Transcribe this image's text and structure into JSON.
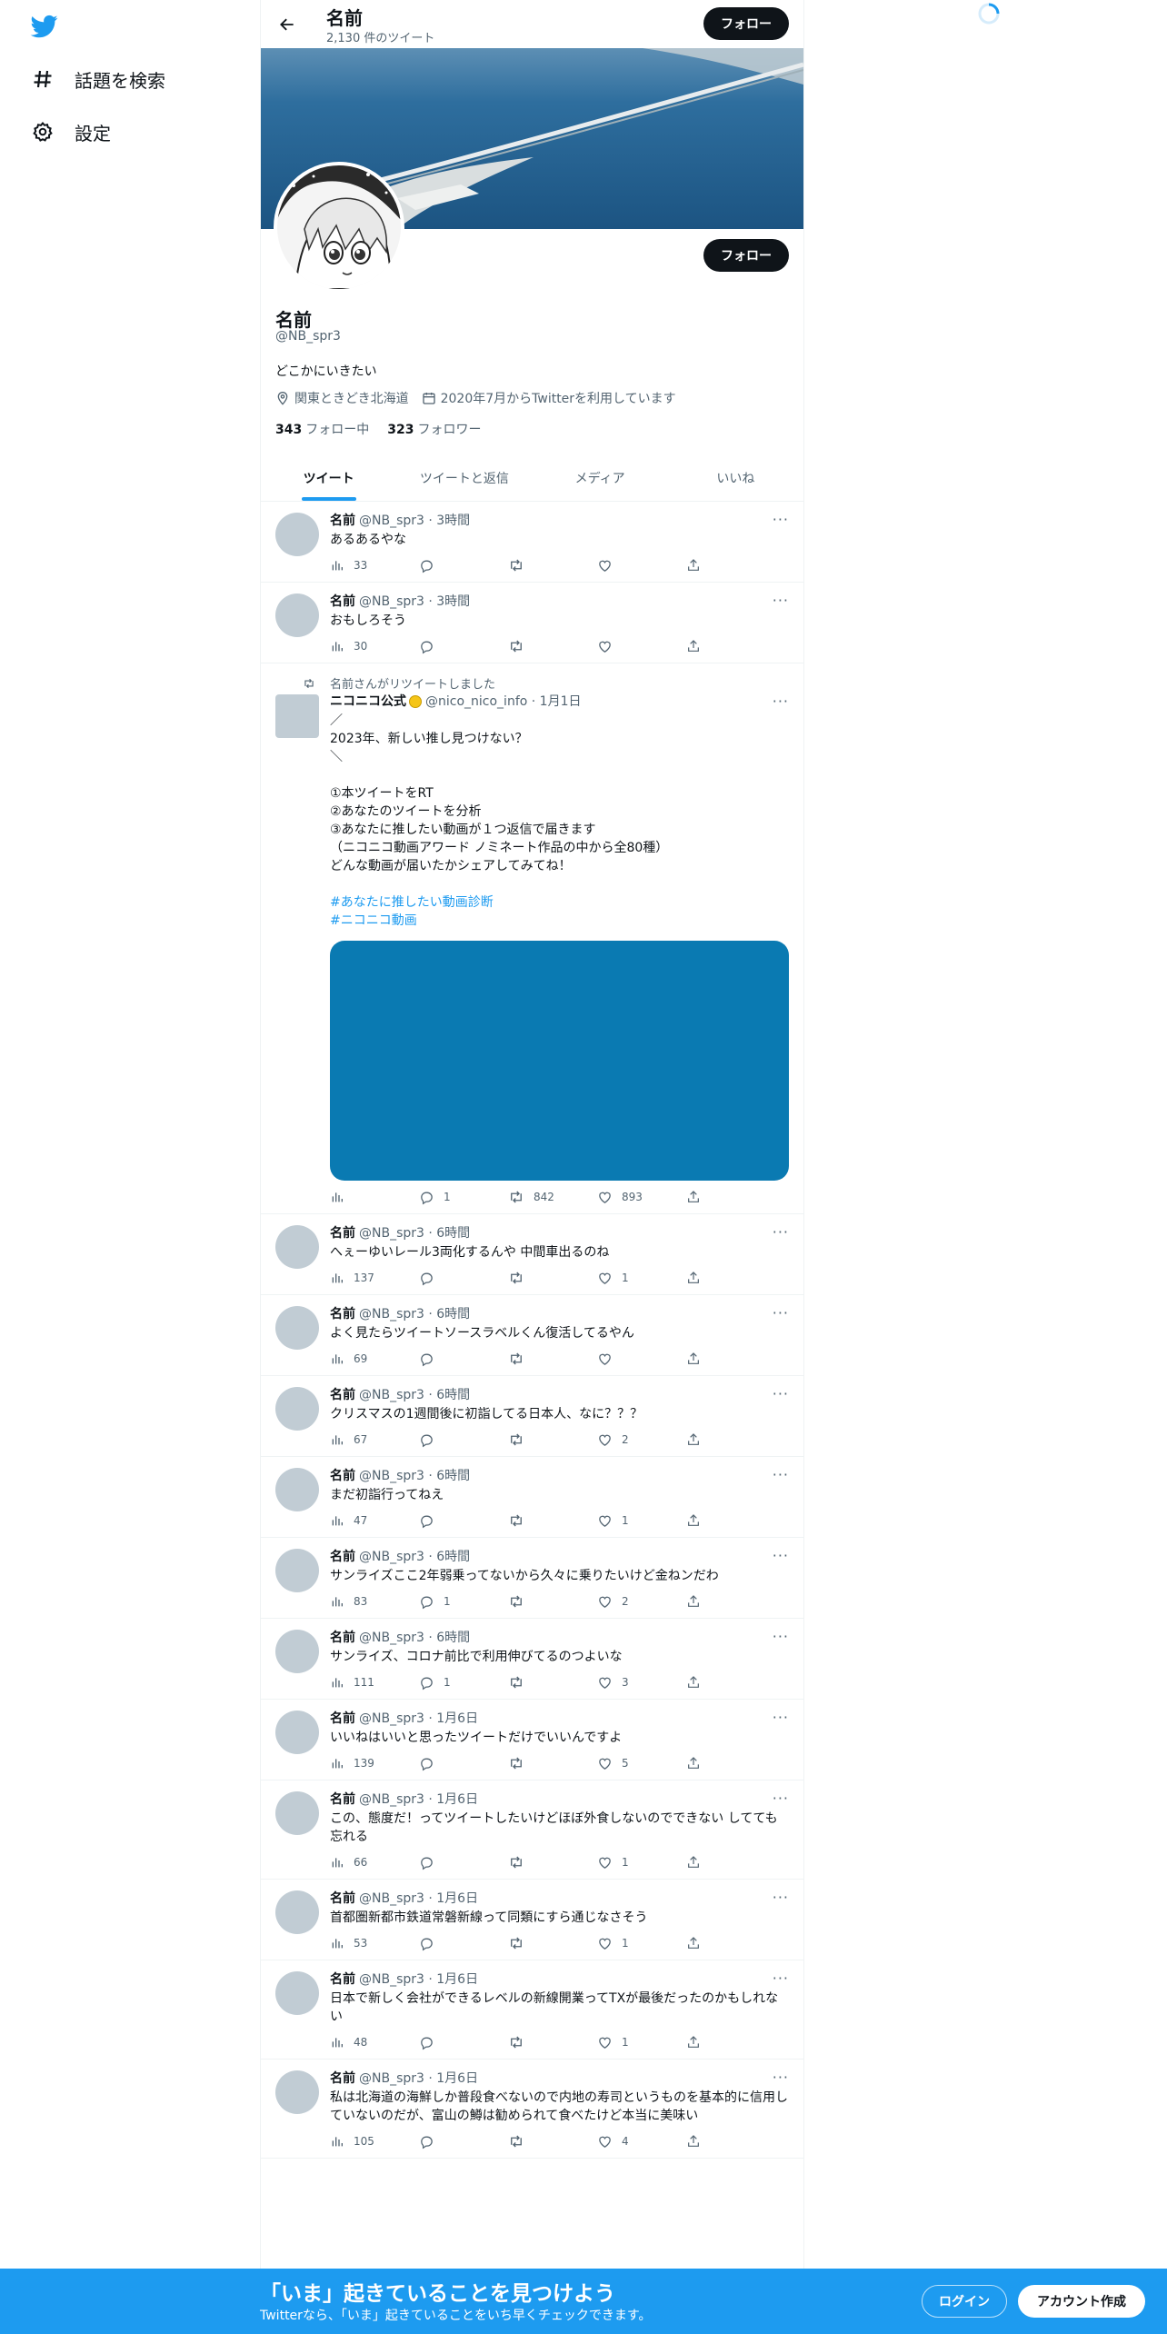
{
  "nav": {
    "items": [
      {
        "icon": "hashtag-icon",
        "label": "話題を検索"
      },
      {
        "icon": "gear-icon",
        "label": "設定"
      }
    ]
  },
  "header": {
    "name": "名前",
    "tweet_count": "2,130 件のツイート",
    "follow_label": "フォロー"
  },
  "profile": {
    "name": "名前",
    "handle": "@NB_spr3",
    "bio": "どこかにいきたい",
    "location": "関東ときどき北海道",
    "joined": "2020年7月からTwitterを利用しています",
    "following_count": "343",
    "following_label": "フォロー中",
    "followers_count": "323",
    "followers_label": "フォロワー",
    "follow_label": "フォロー"
  },
  "tabs": [
    "ツイート",
    "ツイートと返信",
    "メディア",
    "いいね"
  ],
  "tweets": [
    {
      "name": "名前",
      "meta": "@NB_spr3 · 3時間",
      "text": "あるあるやな",
      "views": "33",
      "replies": "",
      "retweets": "",
      "likes": ""
    },
    {
      "name": "名前",
      "meta": "@NB_spr3 · 3時間",
      "text": "おもしろそう",
      "views": "30",
      "replies": "",
      "retweets": "",
      "likes": ""
    },
    {
      "name": "名前",
      "meta": "@NB_spr3 · 6時間",
      "text": "へぇーゆいレール3両化するんや 中間車出るのね",
      "views": "137",
      "replies": "",
      "retweets": "",
      "likes": "1"
    },
    {
      "name": "名前",
      "meta": "@NB_spr3 · 6時間",
      "text": "よく見たらツイートソースラベルくん復活してるやん",
      "views": "69",
      "replies": "",
      "retweets": "",
      "likes": ""
    },
    {
      "name": "名前",
      "meta": "@NB_spr3 · 6時間",
      "text": "クリスマスの1週間後に初詣してる日本人、なに？？？",
      "views": "67",
      "replies": "",
      "retweets": "",
      "likes": "2"
    },
    {
      "name": "名前",
      "meta": "@NB_spr3 · 6時間",
      "text": "まだ初詣行ってねえ",
      "views": "47",
      "replies": "",
      "retweets": "",
      "likes": "1"
    },
    {
      "name": "名前",
      "meta": "@NB_spr3 · 6時間",
      "text": "サンライズここ2年弱乗ってないから久々に乗りたいけど金ねンだわ",
      "views": "83",
      "replies": "1",
      "retweets": "",
      "likes": "2"
    },
    {
      "name": "名前",
      "meta": "@NB_spr3 · 6時間",
      "text": "サンライズ、コロナ前比で利用伸びてるのつよいな",
      "views": "111",
      "replies": "1",
      "retweets": "",
      "likes": "3"
    },
    {
      "name": "名前",
      "meta": "@NB_spr3 · 1月6日",
      "text": "いいねはいいと思ったツイートだけでいいんですよ",
      "views": "139",
      "replies": "",
      "retweets": "",
      "likes": "5"
    },
    {
      "name": "名前",
      "meta": "@NB_spr3 · 1月6日",
      "text": "この、態度だ！ってツイートしたいけどほぼ外食しないのでできない してても忘れる",
      "views": "66",
      "replies": "",
      "retweets": "",
      "likes": "1"
    },
    {
      "name": "名前",
      "meta": "@NB_spr3 · 1月6日",
      "text": "首都圏新都市鉄道常磐新線って同類にすら通じなさそう",
      "views": "53",
      "replies": "",
      "retweets": "",
      "likes": "1"
    },
    {
      "name": "名前",
      "meta": "@NB_spr3 · 1月6日",
      "text": "日本で新しく会社ができるレベルの新線開業ってTXが最後だったのかもしれない",
      "views": "48",
      "replies": "",
      "retweets": "",
      "likes": "1"
    },
    {
      "name": "名前",
      "meta": "@NB_spr3 · 1月6日",
      "text": "私は北海道の海鮮しか普段食べないので内地の寿司というものを基本的に信用していないのだが、富山の鱒は勧められて食べたけど本当に美味い",
      "views": "105",
      "replies": "",
      "retweets": "",
      "likes": "4"
    }
  ],
  "retweet": {
    "rt_label": "名前さんがリツイートしました",
    "name": "ニコニコ公式",
    "meta": "@nico_nico_info · 1月1日",
    "text": "／\n2023年、新しい推し見つけない？\n＼\n\n①本ツイートをRT\n②あなたのツイートを分析\n③あなたに推したい動画が１つ返信で届きます\n（ニコニコ動画アワード ノミネート作品の中から全80種）\nどんな動画が届いたかシェアしてみてね！",
    "tags": [
      "#あなたに推したい動画診断",
      "#ニコニコ動画"
    ],
    "views": "",
    "replies": "1",
    "retweets": "842",
    "likes": "893",
    "media_color": "#0a7ab2"
  },
  "bottom_bar": {
    "title": "「いま」起きていることを見つけよう",
    "subtitle": "Twitterなら、「いま」起きていることをいち早くチェックできます。",
    "login": "ログイン",
    "signup": "アカウント作成"
  },
  "colors": {
    "accent": "#1d9bf0",
    "text": "#0f1419",
    "muted": "#536471"
  }
}
